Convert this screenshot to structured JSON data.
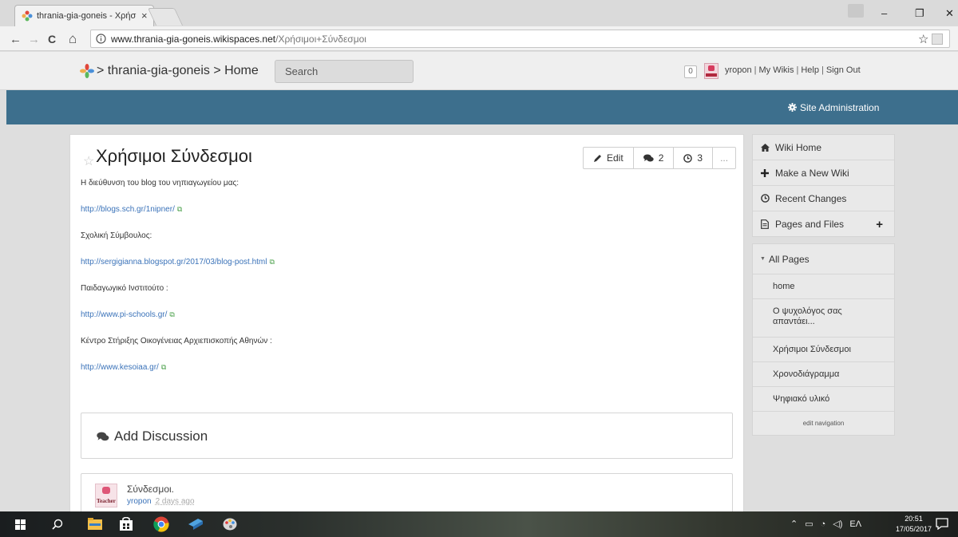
{
  "browser": {
    "tab_title": "thrania-gia-goneis - Χρήσιμοι Σύνδεσμοι",
    "tab_close": "×",
    "url_host": "www.thrania-gia-goneis.wikispaces.net",
    "url_path": "/Χρήσιμοι+Σύνδεσμοι",
    "window_controls": {
      "minimize": "–",
      "maximize": "❐",
      "close": "✕"
    },
    "nav": {
      "back": "←",
      "forward": "→",
      "reload": "C",
      "home": "⌂"
    },
    "star": "☆",
    "menu": "⋮"
  },
  "header": {
    "breadcrumb": "> thrania-gia-goneis > Home",
    "search_placeholder": "Search",
    "notifications": "0",
    "user_links": [
      "yropon",
      "My Wikis",
      "Help",
      "Sign Out"
    ],
    "separator": "|"
  },
  "admin": {
    "label": "Site Administration"
  },
  "page": {
    "title": "Χρήσιμοι Σύνδεσμοι",
    "actions": {
      "edit": "Edit",
      "comments": "2",
      "history": "3",
      "more": "..."
    },
    "lines": [
      {
        "kind": "text",
        "value": "Η διεύθυνση του blog του νηπιαγωγείου μας:"
      },
      {
        "kind": "link",
        "value": "http://blogs.sch.gr/1nipner/"
      },
      {
        "kind": "text",
        "value": "Σχολική Σύμβουλος:"
      },
      {
        "kind": "link",
        "value": "http://sergigianna.blogspot.gr/2017/03/blog-post.html"
      },
      {
        "kind": "text",
        "value": "Παιδαγωγικό Ινστιτούτο :"
      },
      {
        "kind": "link",
        "value": "http://www.pi-schools.gr/"
      },
      {
        "kind": "text",
        "value": "Κέντρο Στήριξης Οικογένειας Αρχιεπισκοπής Αθηνών :"
      },
      {
        "kind": "link",
        "value": "http://www.kesoiaa.gr/"
      }
    ],
    "add_discussion": "Add Discussion",
    "thread": {
      "title": "Σύνδεσμοι.",
      "user": "yropon",
      "date": "2 days ago",
      "avatar_word": "Teacher"
    }
  },
  "sidebar": {
    "top": [
      {
        "label": "Wiki Home",
        "icon": "home-icon"
      },
      {
        "label": "Make a New Wiki",
        "icon": "plus-icon"
      },
      {
        "label": "Recent Changes",
        "icon": "clock-icon"
      },
      {
        "label": "Pages and Files",
        "icon": "file-icon"
      }
    ],
    "pages_and_files_add": "+",
    "pages_header": "All Pages",
    "pages": [
      "home",
      "Ο ψυχολόγος σας απαντάει...",
      "Χρήσιμοι Σύνδεσμοι",
      "Χρονοδιάγραμμα",
      "Ψηφιακό υλικό"
    ],
    "edit_navigation": "edit navigation"
  },
  "taskbar": {
    "tray_language": "ΕΛ",
    "time": "20:51",
    "date": "17/05/2017"
  },
  "colors": {
    "admin_bar": "#3d6f8d",
    "link": "#3b73b9",
    "sidebar_bg": "#e9e9e9"
  }
}
